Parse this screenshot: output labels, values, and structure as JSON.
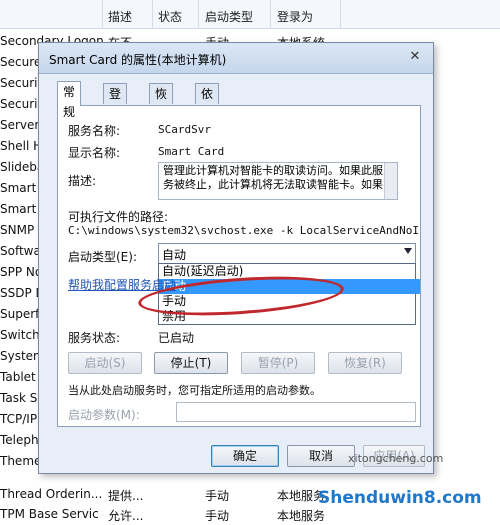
{
  "bg_header": {
    "cols": [
      "描述",
      "状态",
      "启动类型",
      "登录为"
    ]
  },
  "bg_rows": [
    {
      "name": "Secondary Logon",
      "desc": "在不...",
      "status": "",
      "startup": "手动",
      "logon": "本地系统"
    },
    {
      "name": "Secure",
      "desc": "",
      "status": "",
      "startup": "",
      "logon": ""
    },
    {
      "name": "Security",
      "desc": "",
      "status": "",
      "startup": "",
      "logon": ""
    },
    {
      "name": "Security",
      "desc": "",
      "status": "",
      "startup": "",
      "logon": ""
    },
    {
      "name": "Server",
      "desc": "",
      "status": "",
      "startup": "",
      "logon": ""
    },
    {
      "name": "Shell Ha",
      "desc": "",
      "status": "",
      "startup": "",
      "logon": ""
    },
    {
      "name": "Slideba",
      "desc": "",
      "status": "",
      "startup": "",
      "logon": ""
    },
    {
      "name": "Smart C",
      "desc": "",
      "status": "",
      "startup": "",
      "logon": ""
    },
    {
      "name": "Smart C",
      "desc": "",
      "status": "",
      "startup": "",
      "logon": ""
    },
    {
      "name": "SNMP T",
      "desc": "",
      "status": "",
      "startup": "",
      "logon": ""
    },
    {
      "name": "Softwar",
      "desc": "",
      "status": "",
      "startup": "",
      "logon": ""
    },
    {
      "name": "SPP No",
      "desc": "",
      "status": "",
      "startup": "",
      "logon": ""
    },
    {
      "name": "SSDP D",
      "desc": "",
      "status": "",
      "startup": "",
      "logon": ""
    },
    {
      "name": "Superfe",
      "desc": "",
      "status": "",
      "startup": "",
      "logon": ""
    },
    {
      "name": "SwitchB",
      "desc": "",
      "status": "",
      "startup": "",
      "logon": ""
    },
    {
      "name": "System",
      "desc": "",
      "status": "",
      "startup": "",
      "logon": ""
    },
    {
      "name": "Tablet P",
      "desc": "",
      "status": "",
      "startup": "",
      "logon": ""
    },
    {
      "name": "Task Sc",
      "desc": "",
      "status": "",
      "startup": "",
      "logon": ""
    },
    {
      "name": "TCP/IP",
      "desc": "",
      "status": "",
      "startup": "",
      "logon": ""
    },
    {
      "name": "Telepho",
      "desc": "",
      "status": "",
      "startup": "",
      "logon": ""
    },
    {
      "name": "Themes",
      "desc": "",
      "status": "",
      "startup": "",
      "logon": ""
    },
    {
      "name": "Thread Orderin...",
      "desc": "提供...",
      "status": "",
      "startup": "手动",
      "logon": "本地服务"
    },
    {
      "name": "TPM Base Servic",
      "desc": "允许...",
      "status": "",
      "startup": "手动",
      "logon": "本地服务"
    }
  ],
  "dialog": {
    "title": "Smart Card 的属性(本地计算机)",
    "close": "✕",
    "tabs": [
      "常规",
      "登录",
      "恢复",
      "依存关系"
    ],
    "service_name_label": "服务名称:",
    "service_name": "SCardSvr",
    "display_name_label": "显示名称:",
    "display_name": "Smart Card",
    "desc_label": "描述:",
    "desc_text": "管理此计算机对智能卡的取读访问。如果此服务被终止，此计算机将无法取读智能卡。如果",
    "path_label": "可执行文件的路径:",
    "path_value": "C:\\windows\\system32\\svchost.exe -k LocalServiceAndNoImpersor",
    "startup_label": "启动类型(E):",
    "startup_value": "自动",
    "startup_options": [
      "自动(延迟启动)",
      "自动",
      "手动",
      "禁用"
    ],
    "help_link": "帮助我配置服务启动",
    "status_label": "服务状态:",
    "status_value": "已启动",
    "btn_start": "启动(S)",
    "btn_stop": "停止(T)",
    "btn_pause": "暂停(P)",
    "btn_resume": "恢复(R)",
    "hint": "当从此处启动服务时，您可指定所适用的启动参数。",
    "param_label": "启动参数(M):",
    "param_value": "",
    "btn_ok": "确定",
    "btn_cancel": "取消",
    "btn_apply": "应用(A)"
  },
  "watermark": {
    "main": "Shenduwin8.com",
    "sub": "xitongcheng.com"
  }
}
